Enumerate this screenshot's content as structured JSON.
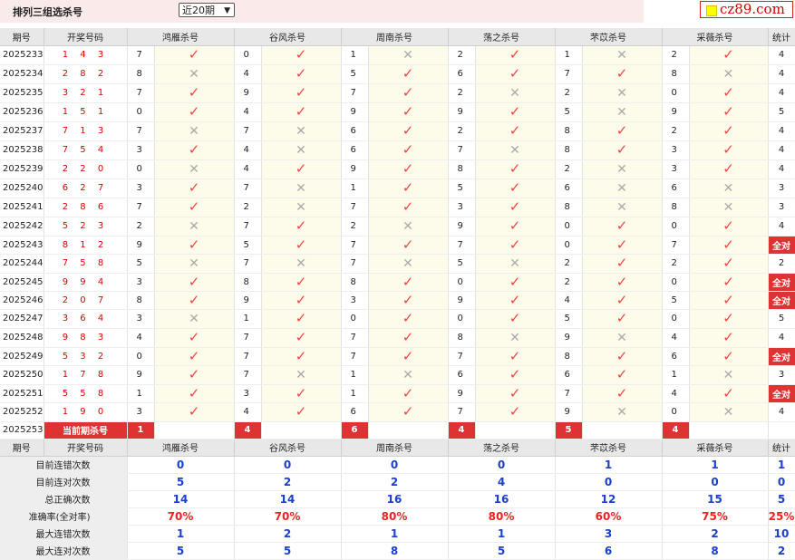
{
  "header": {
    "title": "排列三组选杀号",
    "select_value": "近20期",
    "logo": "cz89.com"
  },
  "columns": {
    "period": "期号",
    "draw": "开奖号码",
    "experts": [
      "鸿雁杀号",
      "谷风杀号",
      "周南杀号",
      "荡之杀号",
      "芣苡杀号",
      "采薇杀号"
    ],
    "stat": "统计"
  },
  "rows": [
    {
      "p": "2025233",
      "d": "1 4 3",
      "k": [
        [
          "7",
          1
        ],
        [
          "0",
          1
        ],
        [
          "1",
          0
        ],
        [
          "2",
          1
        ],
        [
          "1",
          0
        ],
        [
          "2",
          1
        ]
      ],
      "s": "4"
    },
    {
      "p": "2025234",
      "d": "2 8 2",
      "k": [
        [
          "8",
          0
        ],
        [
          "4",
          1
        ],
        [
          "5",
          1
        ],
        [
          "6",
          1
        ],
        [
          "7",
          1
        ],
        [
          "8",
          0
        ]
      ],
      "s": "4"
    },
    {
      "p": "2025235",
      "d": "3 2 1",
      "k": [
        [
          "7",
          1
        ],
        [
          "9",
          1
        ],
        [
          "7",
          1
        ],
        [
          "2",
          0
        ],
        [
          "2",
          0
        ],
        [
          "0",
          1
        ]
      ],
      "s": "4"
    },
    {
      "p": "2025236",
      "d": "1 5 1",
      "k": [
        [
          "0",
          1
        ],
        [
          "4",
          1
        ],
        [
          "9",
          1
        ],
        [
          "9",
          1
        ],
        [
          "5",
          0
        ],
        [
          "9",
          1
        ]
      ],
      "s": "5"
    },
    {
      "p": "2025237",
      "d": "7 1 3",
      "k": [
        [
          "7",
          0
        ],
        [
          "7",
          0
        ],
        [
          "6",
          1
        ],
        [
          "2",
          1
        ],
        [
          "8",
          1
        ],
        [
          "2",
          1
        ]
      ],
      "s": "4"
    },
    {
      "p": "2025238",
      "d": "7 5 4",
      "k": [
        [
          "3",
          1
        ],
        [
          "4",
          0
        ],
        [
          "6",
          1
        ],
        [
          "7",
          0
        ],
        [
          "8",
          1
        ],
        [
          "3",
          1
        ]
      ],
      "s": "4"
    },
    {
      "p": "2025239",
      "d": "2 2 0",
      "k": [
        [
          "0",
          0
        ],
        [
          "4",
          1
        ],
        [
          "9",
          1
        ],
        [
          "8",
          1
        ],
        [
          "2",
          0
        ],
        [
          "3",
          1
        ]
      ],
      "s": "4"
    },
    {
      "p": "2025240",
      "d": "6 2 7",
      "k": [
        [
          "3",
          1
        ],
        [
          "7",
          0
        ],
        [
          "1",
          1
        ],
        [
          "5",
          1
        ],
        [
          "6",
          0
        ],
        [
          "6",
          0
        ]
      ],
      "s": "3"
    },
    {
      "p": "2025241",
      "d": "2 8 6",
      "k": [
        [
          "7",
          1
        ],
        [
          "2",
          0
        ],
        [
          "7",
          1
        ],
        [
          "3",
          1
        ],
        [
          "8",
          0
        ],
        [
          "8",
          0
        ]
      ],
      "s": "3"
    },
    {
      "p": "2025242",
      "d": "5 2 3",
      "k": [
        [
          "2",
          0
        ],
        [
          "7",
          1
        ],
        [
          "2",
          0
        ],
        [
          "9",
          1
        ],
        [
          "0",
          1
        ],
        [
          "0",
          1
        ]
      ],
      "s": "4"
    },
    {
      "p": "2025243",
      "d": "8 1 2",
      "k": [
        [
          "9",
          1
        ],
        [
          "5",
          1
        ],
        [
          "7",
          1
        ],
        [
          "7",
          1
        ],
        [
          "0",
          1
        ],
        [
          "7",
          1
        ]
      ],
      "s": "全对"
    },
    {
      "p": "2025244",
      "d": "7 5 8",
      "k": [
        [
          "5",
          0
        ],
        [
          "7",
          0
        ],
        [
          "7",
          0
        ],
        [
          "5",
          0
        ],
        [
          "2",
          1
        ],
        [
          "2",
          1
        ]
      ],
      "s": "2"
    },
    {
      "p": "2025245",
      "d": "9 9 4",
      "k": [
        [
          "3",
          1
        ],
        [
          "8",
          1
        ],
        [
          "8",
          1
        ],
        [
          "0",
          1
        ],
        [
          "2",
          1
        ],
        [
          "0",
          1
        ]
      ],
      "s": "全对"
    },
    {
      "p": "2025246",
      "d": "2 0 7",
      "k": [
        [
          "8",
          1
        ],
        [
          "9",
          1
        ],
        [
          "3",
          1
        ],
        [
          "9",
          1
        ],
        [
          "4",
          1
        ],
        [
          "5",
          1
        ]
      ],
      "s": "全对"
    },
    {
      "p": "2025247",
      "d": "3 6 4",
      "k": [
        [
          "3",
          0
        ],
        [
          "1",
          1
        ],
        [
          "0",
          1
        ],
        [
          "0",
          1
        ],
        [
          "5",
          1
        ],
        [
          "0",
          1
        ]
      ],
      "s": "5"
    },
    {
      "p": "2025248",
      "d": "9 8 3",
      "k": [
        [
          "4",
          1
        ],
        [
          "7",
          1
        ],
        [
          "7",
          1
        ],
        [
          "8",
          0
        ],
        [
          "9",
          0
        ],
        [
          "4",
          1
        ]
      ],
      "s": "4"
    },
    {
      "p": "2025249",
      "d": "5 3 2",
      "k": [
        [
          "0",
          1
        ],
        [
          "7",
          1
        ],
        [
          "7",
          1
        ],
        [
          "7",
          1
        ],
        [
          "8",
          1
        ],
        [
          "6",
          1
        ]
      ],
      "s": "全对"
    },
    {
      "p": "2025250",
      "d": "1 7 8",
      "k": [
        [
          "9",
          1
        ],
        [
          "7",
          0
        ],
        [
          "1",
          0
        ],
        [
          "6",
          1
        ],
        [
          "6",
          1
        ],
        [
          "1",
          0
        ]
      ],
      "s": "3"
    },
    {
      "p": "2025251",
      "d": "5 5 8",
      "k": [
        [
          "1",
          1
        ],
        [
          "3",
          1
        ],
        [
          "1",
          1
        ],
        [
          "9",
          1
        ],
        [
          "7",
          1
        ],
        [
          "4",
          1
        ]
      ],
      "s": "全对"
    },
    {
      "p": "2025252",
      "d": "1 9 0",
      "k": [
        [
          "3",
          1
        ],
        [
          "4",
          1
        ],
        [
          "6",
          1
        ],
        [
          "7",
          1
        ],
        [
          "9",
          0
        ],
        [
          "0",
          0
        ]
      ],
      "s": "4"
    }
  ],
  "current": {
    "period": "2025253",
    "label": "当前期杀号",
    "values": [
      "1",
      "4",
      "6",
      "4",
      "5",
      "4"
    ]
  },
  "stats": [
    {
      "label": "目前连错次数",
      "vals": [
        "0",
        "0",
        "0",
        "0",
        "1",
        "1"
      ],
      "stat": "1",
      "red": false
    },
    {
      "label": "目前连对次数",
      "vals": [
        "5",
        "2",
        "2",
        "4",
        "0",
        "0"
      ],
      "stat": "0",
      "red": false
    },
    {
      "label": "总正确次数",
      "vals": [
        "14",
        "14",
        "16",
        "16",
        "12",
        "15"
      ],
      "stat": "5",
      "red": false
    },
    {
      "label": "准确率(全对率)",
      "vals": [
        "70%",
        "70%",
        "80%",
        "80%",
        "60%",
        "75%"
      ],
      "stat": "25%",
      "red": true
    },
    {
      "label": "最大连错次数",
      "vals": [
        "1",
        "2",
        "1",
        "1",
        "3",
        "2"
      ],
      "stat": "10",
      "red": false
    },
    {
      "label": "最大连对次数",
      "vals": [
        "5",
        "5",
        "8",
        "5",
        "6",
        "8"
      ],
      "stat": "2",
      "red": false
    }
  ]
}
